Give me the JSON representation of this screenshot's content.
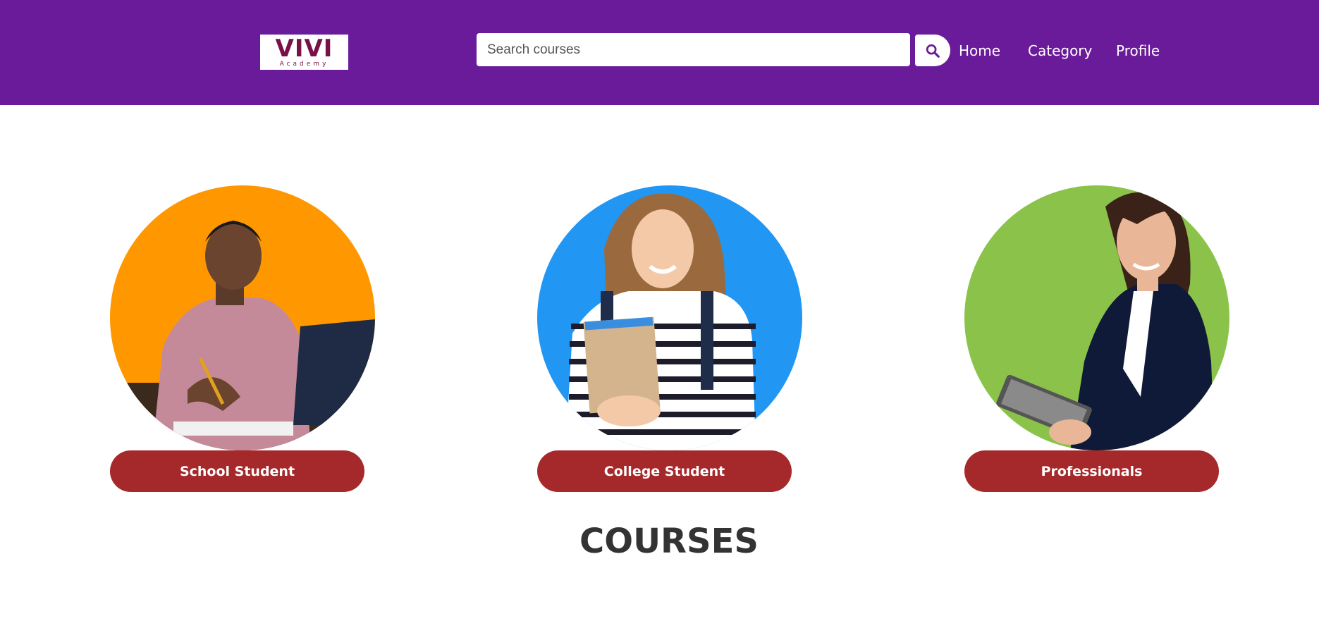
{
  "header": {
    "logo": {
      "main": "VIVI",
      "sub": "Academy"
    },
    "search": {
      "placeholder": "Search courses",
      "value": ""
    },
    "search_icon": "search-icon",
    "nav": [
      {
        "label": "Home"
      },
      {
        "label": "Category"
      },
      {
        "label": "Profile"
      }
    ]
  },
  "categories": [
    {
      "label": "School Student",
      "image": "student-writing-at-laptop",
      "bg_color": "#ff9800"
    },
    {
      "label": "College Student",
      "image": "student-holding-notebook",
      "bg_color": "#2196f3"
    },
    {
      "label": "Professionals",
      "image": "professional-woman-with-tablet",
      "bg_color": "#8bc34a"
    }
  ],
  "section": {
    "title": "COURSES"
  },
  "colors": {
    "header_bg": "#6a1b9a",
    "button_bg": "#a5292a",
    "logo_color": "#7a1048"
  }
}
